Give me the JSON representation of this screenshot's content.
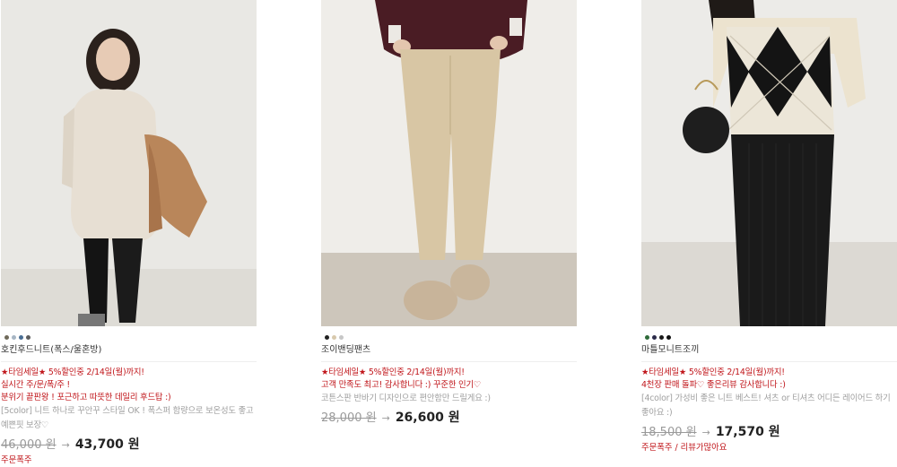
{
  "products": [
    {
      "name": "호킨후드니트(폭스/울혼방)",
      "swatches": [
        "#6f6a5a",
        "#a7b6c4",
        "#4a6e94",
        "#5d5d5d"
      ],
      "promo_lines": [
        "★타임세일★ 5%할인중 2/14일(월)까지!",
        "실시간 주/문/폭/주 !",
        "분위기 끝판왕 ! 포근하고 따뜻한 데일리 후드탑 :)"
      ],
      "description": "[5color] 니트 하나로 꾸안꾸 스타일 OK ! 폭스퍼 함량으로 보온성도 좋고 예쁜핏 보장♡",
      "old_price": "46,000 원",
      "arrow": "→",
      "new_price": "43,700 원",
      "review": "주문폭주"
    },
    {
      "name": "조이밴딩팬츠",
      "swatches": [
        "#222222",
        "#d8c9ad",
        "#c7c7c7"
      ],
      "promo_lines": [
        "★타임세일★ 5%할인중 2/14일(월)까지!",
        "고객 만족도 최고! 감사합니다 :) 꾸준한 인기♡"
      ],
      "description": "코튼스판 반바기 디자인으로 편안함만 드릴게요 :)",
      "old_price": "28,000 원",
      "arrow": "→",
      "new_price": "26,600 원",
      "review": ""
    },
    {
      "name": "마틀모니트조끼",
      "swatches": [
        "#2f6b3a",
        "#2b2b4a",
        "#1a1a1a",
        "#111111"
      ],
      "promo_lines": [
        "★타임세일★ 5%할인중 2/14일(월)까지!",
        "4천장 판매 돌파♡ 좋은리뷰 감사합니다 :)"
      ],
      "description": "[4color] 가성비 좋은 니트 베스트! 셔츠 or 티셔츠 어디든 레이어드 하기 좋아요 :)",
      "old_price": "18,500 원",
      "arrow": "→",
      "new_price": "17,570 원",
      "review": "주문폭주 / 리뷰가많아요"
    }
  ]
}
